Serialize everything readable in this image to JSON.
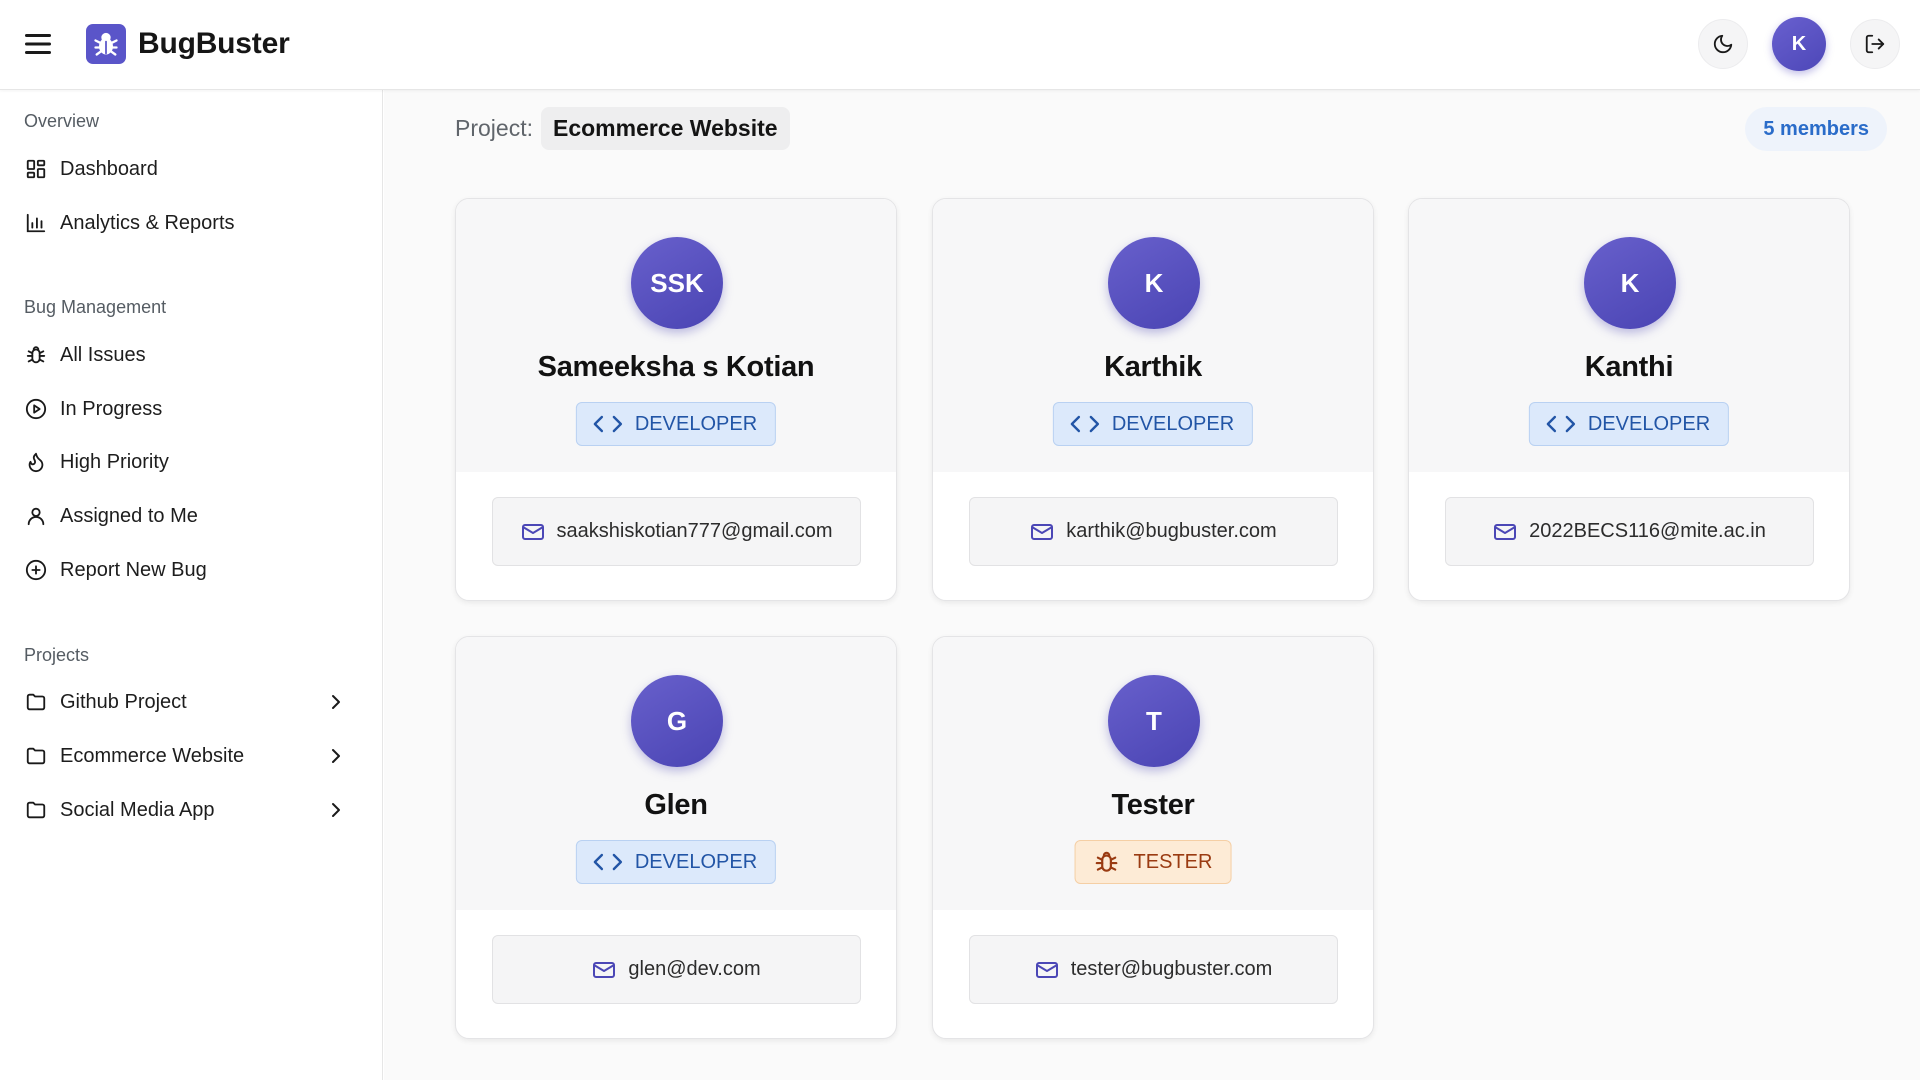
{
  "app": {
    "name": "BugBuster",
    "user_initial": "K",
    "colors": {
      "accent": "#5a55c9",
      "link": "#2a6cc9",
      "developer_badge": "#dce9fb",
      "tester_badge": "#fdebd6"
    }
  },
  "header": {
    "menu_icon": "hamburger-menu-icon",
    "logo_icon": "bug-logo-icon",
    "theme_icon": "moon-icon",
    "logout_icon": "logout-icon"
  },
  "sidebar": {
    "sections": [
      {
        "title": "Overview",
        "items": [
          {
            "label": "Dashboard",
            "icon": "dashboard-icon"
          },
          {
            "label": "Analytics & Reports",
            "icon": "bar-chart-icon"
          }
        ]
      },
      {
        "title": "Bug Management",
        "items": [
          {
            "label": "All Issues",
            "icon": "bug-icon"
          },
          {
            "label": "In Progress",
            "icon": "play-circle-icon"
          },
          {
            "label": "High Priority",
            "icon": "flame-icon"
          },
          {
            "label": "Assigned to Me",
            "icon": "user-icon"
          },
          {
            "label": "Report New Bug",
            "icon": "plus-circle-icon"
          }
        ]
      },
      {
        "title": "Projects",
        "items": [
          {
            "label": "Github Project",
            "icon": "folder-icon"
          },
          {
            "label": "Ecommerce Website",
            "icon": "folder-icon"
          },
          {
            "label": "Social Media App",
            "icon": "folder-icon"
          }
        ]
      }
    ]
  },
  "main": {
    "project_prefix": "Project:",
    "project_name": "Ecommerce Website",
    "members_count": "5 members",
    "members": [
      {
        "initials": "SSK",
        "name": "Sameeksha s Kotian",
        "role": "DEVELOPER",
        "role_icon": "code-icon",
        "email": "saakshiskotian777@gmail.com"
      },
      {
        "initials": "K",
        "name": "Karthik",
        "role": "DEVELOPER",
        "role_icon": "code-icon",
        "email": "karthik@bugbuster.com"
      },
      {
        "initials": "K",
        "name": "Kanthi",
        "role": "DEVELOPER",
        "role_icon": "code-icon",
        "email": "2022BECS116@mite.ac.in"
      },
      {
        "initials": "G",
        "name": "Glen",
        "role": "DEVELOPER",
        "role_icon": "code-icon",
        "email": "glen@dev.com"
      },
      {
        "initials": "T",
        "name": "Tester",
        "role": "TESTER",
        "role_icon": "bug-icon",
        "email": "tester@bugbuster.com"
      }
    ]
  }
}
